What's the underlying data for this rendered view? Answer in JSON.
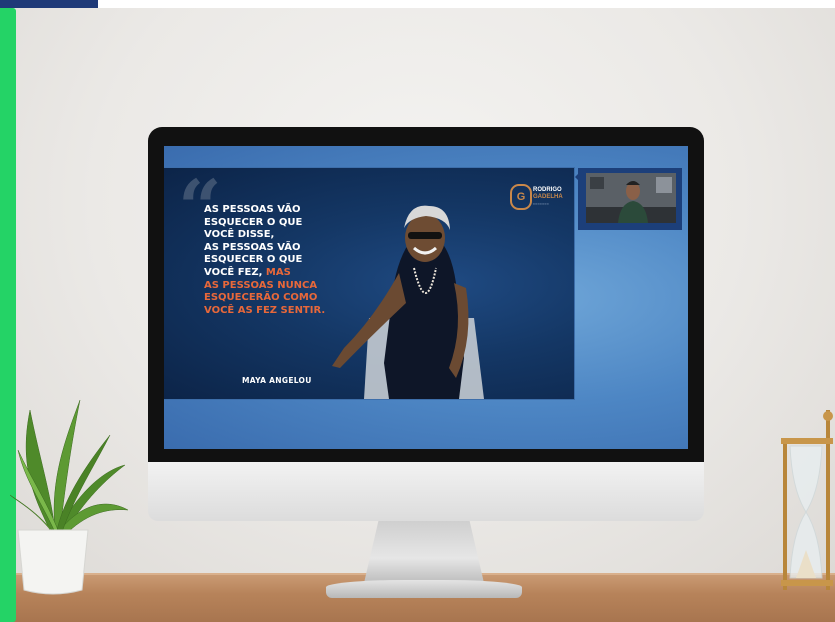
{
  "slide": {
    "quote_lines_white": "AS PESSOAS VÃO\nESQUECER O QUE\nVOCÊ DISSE,\nAS PESSOAS VÃO\nESQUECER O QUE\nVOCÊ FEZ, ",
    "quote_highlight_1": "MAS",
    "quote_highlight_2": "AS PESSOAS NUNCA\nESQUECERÃO COMO\nVOCÊ AS FEZ SENTIR.",
    "author": "MAYA ANGELOU",
    "logo_line1": "RODRIGO",
    "logo_line2": "GADELHA",
    "logo_seal": "G"
  },
  "colors": {
    "accent_green": "#24d366",
    "highlight_orange": "#e8683a",
    "brand_navy": "#1f3a78"
  }
}
